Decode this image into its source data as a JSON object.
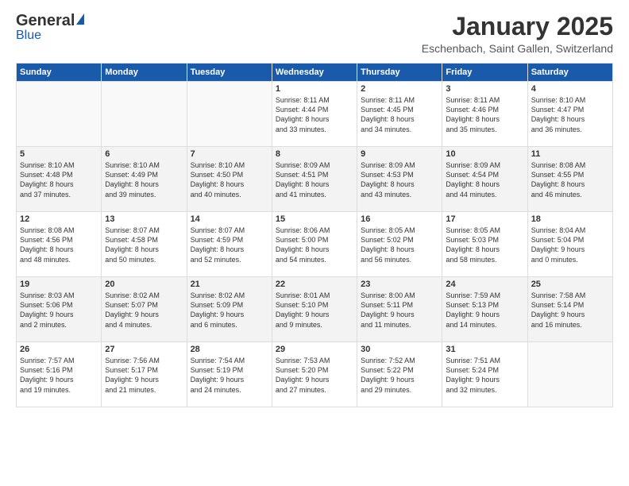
{
  "logo": {
    "general": "General",
    "blue": "Blue"
  },
  "header": {
    "month": "January 2025",
    "location": "Eschenbach, Saint Gallen, Switzerland"
  },
  "weekdays": [
    "Sunday",
    "Monday",
    "Tuesday",
    "Wednesday",
    "Thursday",
    "Friday",
    "Saturday"
  ],
  "weeks": [
    [
      {
        "day": "",
        "info": ""
      },
      {
        "day": "",
        "info": ""
      },
      {
        "day": "",
        "info": ""
      },
      {
        "day": "1",
        "info": "Sunrise: 8:11 AM\nSunset: 4:44 PM\nDaylight: 8 hours\nand 33 minutes."
      },
      {
        "day": "2",
        "info": "Sunrise: 8:11 AM\nSunset: 4:45 PM\nDaylight: 8 hours\nand 34 minutes."
      },
      {
        "day": "3",
        "info": "Sunrise: 8:11 AM\nSunset: 4:46 PM\nDaylight: 8 hours\nand 35 minutes."
      },
      {
        "day": "4",
        "info": "Sunrise: 8:10 AM\nSunset: 4:47 PM\nDaylight: 8 hours\nand 36 minutes."
      }
    ],
    [
      {
        "day": "5",
        "info": "Sunrise: 8:10 AM\nSunset: 4:48 PM\nDaylight: 8 hours\nand 37 minutes."
      },
      {
        "day": "6",
        "info": "Sunrise: 8:10 AM\nSunset: 4:49 PM\nDaylight: 8 hours\nand 39 minutes."
      },
      {
        "day": "7",
        "info": "Sunrise: 8:10 AM\nSunset: 4:50 PM\nDaylight: 8 hours\nand 40 minutes."
      },
      {
        "day": "8",
        "info": "Sunrise: 8:09 AM\nSunset: 4:51 PM\nDaylight: 8 hours\nand 41 minutes."
      },
      {
        "day": "9",
        "info": "Sunrise: 8:09 AM\nSunset: 4:53 PM\nDaylight: 8 hours\nand 43 minutes."
      },
      {
        "day": "10",
        "info": "Sunrise: 8:09 AM\nSunset: 4:54 PM\nDaylight: 8 hours\nand 44 minutes."
      },
      {
        "day": "11",
        "info": "Sunrise: 8:08 AM\nSunset: 4:55 PM\nDaylight: 8 hours\nand 46 minutes."
      }
    ],
    [
      {
        "day": "12",
        "info": "Sunrise: 8:08 AM\nSunset: 4:56 PM\nDaylight: 8 hours\nand 48 minutes."
      },
      {
        "day": "13",
        "info": "Sunrise: 8:07 AM\nSunset: 4:58 PM\nDaylight: 8 hours\nand 50 minutes."
      },
      {
        "day": "14",
        "info": "Sunrise: 8:07 AM\nSunset: 4:59 PM\nDaylight: 8 hours\nand 52 minutes."
      },
      {
        "day": "15",
        "info": "Sunrise: 8:06 AM\nSunset: 5:00 PM\nDaylight: 8 hours\nand 54 minutes."
      },
      {
        "day": "16",
        "info": "Sunrise: 8:05 AM\nSunset: 5:02 PM\nDaylight: 8 hours\nand 56 minutes."
      },
      {
        "day": "17",
        "info": "Sunrise: 8:05 AM\nSunset: 5:03 PM\nDaylight: 8 hours\nand 58 minutes."
      },
      {
        "day": "18",
        "info": "Sunrise: 8:04 AM\nSunset: 5:04 PM\nDaylight: 9 hours\nand 0 minutes."
      }
    ],
    [
      {
        "day": "19",
        "info": "Sunrise: 8:03 AM\nSunset: 5:06 PM\nDaylight: 9 hours\nand 2 minutes."
      },
      {
        "day": "20",
        "info": "Sunrise: 8:02 AM\nSunset: 5:07 PM\nDaylight: 9 hours\nand 4 minutes."
      },
      {
        "day": "21",
        "info": "Sunrise: 8:02 AM\nSunset: 5:09 PM\nDaylight: 9 hours\nand 6 minutes."
      },
      {
        "day": "22",
        "info": "Sunrise: 8:01 AM\nSunset: 5:10 PM\nDaylight: 9 hours\nand 9 minutes."
      },
      {
        "day": "23",
        "info": "Sunrise: 8:00 AM\nSunset: 5:11 PM\nDaylight: 9 hours\nand 11 minutes."
      },
      {
        "day": "24",
        "info": "Sunrise: 7:59 AM\nSunset: 5:13 PM\nDaylight: 9 hours\nand 14 minutes."
      },
      {
        "day": "25",
        "info": "Sunrise: 7:58 AM\nSunset: 5:14 PM\nDaylight: 9 hours\nand 16 minutes."
      }
    ],
    [
      {
        "day": "26",
        "info": "Sunrise: 7:57 AM\nSunset: 5:16 PM\nDaylight: 9 hours\nand 19 minutes."
      },
      {
        "day": "27",
        "info": "Sunrise: 7:56 AM\nSunset: 5:17 PM\nDaylight: 9 hours\nand 21 minutes."
      },
      {
        "day": "28",
        "info": "Sunrise: 7:54 AM\nSunset: 5:19 PM\nDaylight: 9 hours\nand 24 minutes."
      },
      {
        "day": "29",
        "info": "Sunrise: 7:53 AM\nSunset: 5:20 PM\nDaylight: 9 hours\nand 27 minutes."
      },
      {
        "day": "30",
        "info": "Sunrise: 7:52 AM\nSunset: 5:22 PM\nDaylight: 9 hours\nand 29 minutes."
      },
      {
        "day": "31",
        "info": "Sunrise: 7:51 AM\nSunset: 5:24 PM\nDaylight: 9 hours\nand 32 minutes."
      },
      {
        "day": "",
        "info": ""
      }
    ]
  ]
}
